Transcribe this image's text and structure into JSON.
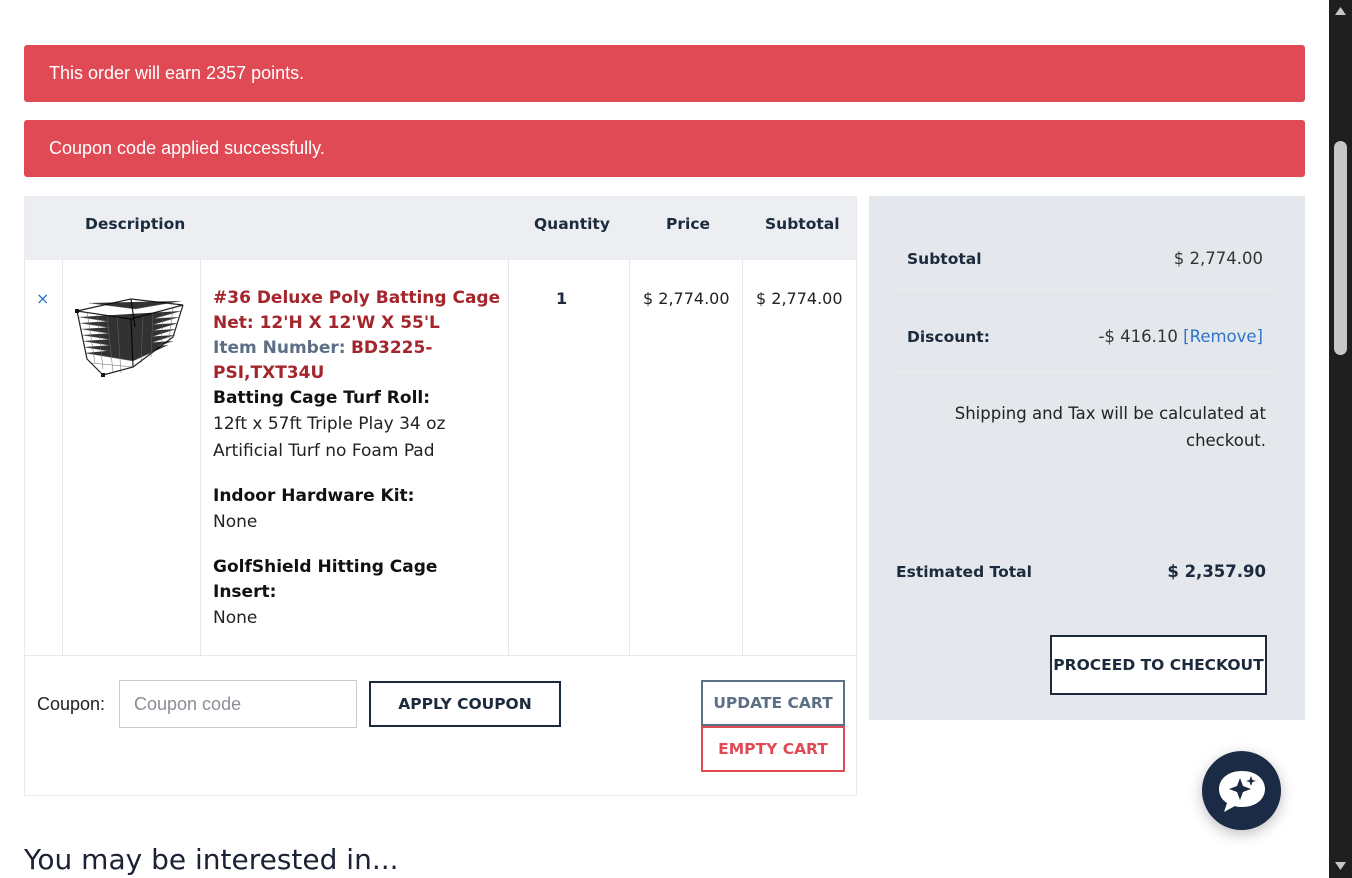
{
  "notices": {
    "points": "This order will earn 2357 points.",
    "coupon": "Coupon code applied successfully."
  },
  "cart": {
    "headers": {
      "description": "Description",
      "quantity": "Quantity",
      "price": "Price",
      "subtotal": "Subtotal"
    },
    "item": {
      "remove_symbol": "×",
      "title": "#36 Deluxe Poly Batting Cage Net: 12'H X 12'W X 55'L",
      "item_number_label": "Item Number:",
      "item_number": "BD3225-PSI,TXT34U",
      "options": [
        {
          "label": "Batting Cage Turf Roll:",
          "value": "12ft x 57ft Triple Play 34 oz Artificial Turf no Foam Pad"
        },
        {
          "label": "Indoor Hardware Kit:",
          "value": "None"
        },
        {
          "label": "GolfShield Hitting Cage Insert:",
          "value": "None"
        }
      ],
      "quantity": "1",
      "price": "$ 2,774.00",
      "subtotal": "$ 2,774.00"
    },
    "coupon": {
      "label": "Coupon:",
      "placeholder": "Coupon code",
      "apply_label": "APPLY COUPON"
    },
    "update_label": "UPDATE CART",
    "empty_label": "EMPTY CART"
  },
  "summary": {
    "subtotal_label": "Subtotal",
    "subtotal_value": "$ 2,774.00",
    "discount_label": "Discount:",
    "discount_value": "-$ 416.10",
    "discount_remove": "[Remove]",
    "shipping_note": "Shipping and Tax will be calculated at checkout.",
    "estimated_label": "Estimated Total",
    "estimated_value": "$ 2,357.90",
    "checkout_label": "PROCEED TO CHECKOUT"
  },
  "related": {
    "title": "You may be interested in..."
  },
  "colors": {
    "notice_bg": "#e04a55",
    "brand_navy": "#1b2a3d",
    "product_red": "#a4262c",
    "link_blue": "#2f74c8"
  },
  "icons": {
    "chat": "chat-sparkle-icon",
    "product": "batting-cage-net-image"
  }
}
